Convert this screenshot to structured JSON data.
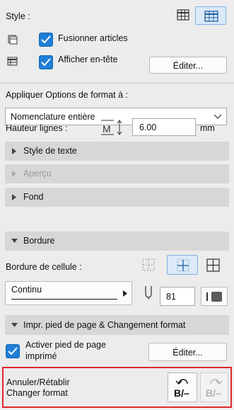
{
  "style": {
    "label": "Style :",
    "merge_items": "Fusionner articles",
    "show_header": "Afficher en-tête",
    "edit_header_button": "Éditer..."
  },
  "apply_format": {
    "label": "Appliquer Options de format à :",
    "selected": "Nomenclature entière"
  },
  "row_height": {
    "label": "Hauteur lignes :",
    "value": "6.00",
    "unit": "mm"
  },
  "sections": {
    "text_style": "Style de texte",
    "preview": "Aperçu",
    "background": "Fond",
    "border": "Bordure",
    "footer": "Impr. pied de page & Changement format"
  },
  "border": {
    "label": "Bordure de cellule :",
    "line_type": "Continu",
    "pen_value": "81"
  },
  "footer": {
    "activate_line1": "Activer pied de page",
    "activate_line2": "imprimé",
    "edit_button": "Éditer..."
  },
  "undo": {
    "line1": "Annuler/Rétablir",
    "line2": "Changer format",
    "undo_glyph": "B/–",
    "redo_glyph": "B/–"
  },
  "colors": {
    "accent": "#1e7fd6",
    "highlight": "#e0282e",
    "section_bg": "#d7d7d7"
  }
}
